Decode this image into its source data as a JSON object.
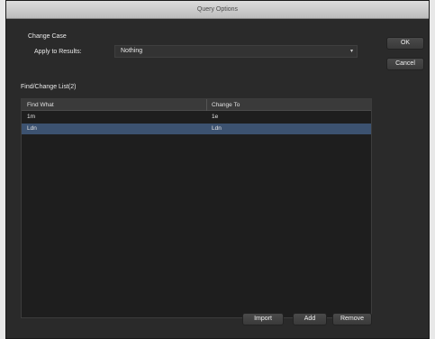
{
  "window": {
    "title": "Query Options"
  },
  "change_case": {
    "section_title": "Change Case",
    "apply_label": "Apply to Results:",
    "selected_value": "Nothing"
  },
  "list": {
    "label": "Find/Change List(2)",
    "columns": [
      "Find What",
      "Change To"
    ],
    "rows": [
      {
        "find": "1m",
        "change": "1e"
      },
      {
        "find": "Ldn",
        "change": "Ldn"
      }
    ]
  },
  "buttons": {
    "ok": "OK",
    "cancel": "Cancel",
    "import": "Import",
    "add": "Add",
    "remove": "Remove"
  },
  "colors": {
    "window_bg": "#2a2a2a",
    "selected_row": "#3c5270"
  }
}
